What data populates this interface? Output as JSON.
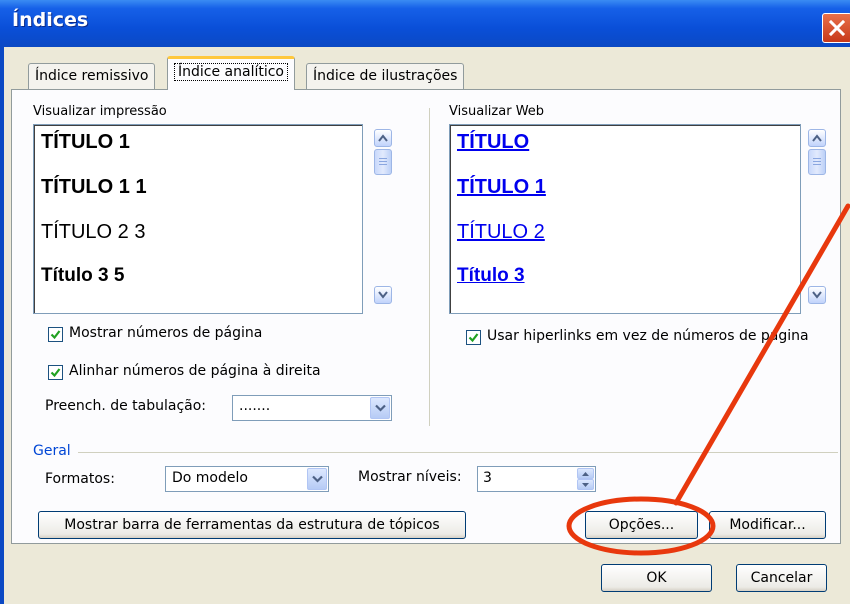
{
  "window": {
    "title": "Índices"
  },
  "tabs": [
    {
      "label": "Índice remissivo",
      "accel_index": 0
    },
    {
      "label": "Índice analítico",
      "accel_index": 0,
      "active": true
    },
    {
      "label": "Índice de ilustrações",
      "accel_index": 14
    }
  ],
  "print_preview": {
    "label": "Visualizar impressão",
    "items": [
      "TÍTULO 1",
      "TÍTULO 1 1",
      "TÍTULO 2 3",
      "Título 3 5"
    ]
  },
  "web_preview": {
    "label": "Visualizar Web",
    "items": [
      "TÍTULO",
      "TÍTULO 1",
      "TÍTULO 2",
      "Título 3"
    ]
  },
  "options": {
    "show_page_numbers": {
      "label": "Mostrar números de página",
      "checked": true
    },
    "align_right": {
      "label": "Alinhar números de página à direita",
      "checked": true
    },
    "use_hyperlinks": {
      "label": "Usar hiperlinks em vez de números de página",
      "checked": true
    },
    "tab_leader_label": "Preench. de tabulação:",
    "tab_leader_value": "......."
  },
  "general": {
    "group_label": "Geral",
    "formats_label": "Formatos:",
    "formats_value": "Do modelo",
    "levels_label": "Mostrar níveis:",
    "levels_value": "3"
  },
  "buttons": {
    "outline_toolbar": "Mostrar barra de ferramentas da estrutura de tópicos",
    "options": "Opções...",
    "modify": "Modificar...",
    "ok": "OK",
    "cancel": "Cancelar"
  },
  "colors": {
    "title_bar": "#0b49c4",
    "link": "#0000ee",
    "annotation": "#e8380d"
  }
}
